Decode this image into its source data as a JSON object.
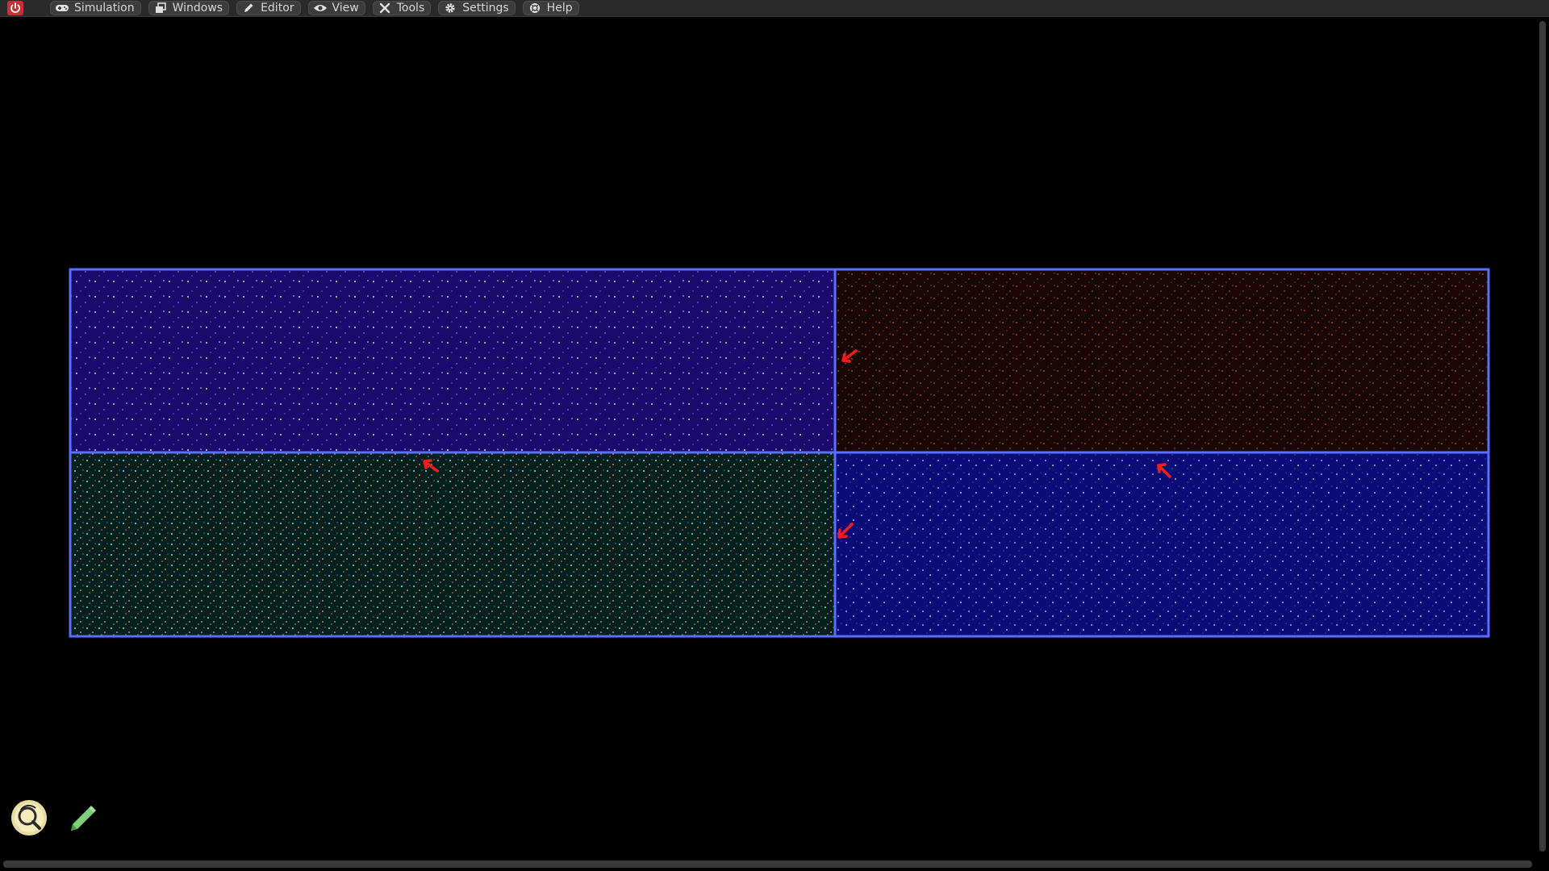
{
  "menubar": {
    "power_icon": "power-icon",
    "items": [
      {
        "label": "Simulation",
        "icon": "gamepad-icon"
      },
      {
        "label": "Windows",
        "icon": "windows-icon"
      },
      {
        "label": "Editor",
        "icon": "pencil-icon"
      },
      {
        "label": "View",
        "icon": "eye-icon"
      },
      {
        "label": "Tools",
        "icon": "wrench-icon"
      },
      {
        "label": "Settings",
        "icon": "gear-icon"
      },
      {
        "label": "Help",
        "icon": "help-icon"
      }
    ]
  },
  "colors": {
    "menubar_bg": "#2a2a2a",
    "menu_button_bg": "#3c3c3c",
    "menu_text": "#d6d6d6",
    "power_red": "#e8404a",
    "region_border": "#5a6eff",
    "arrow_red": "#ff1a1a",
    "region_top_left": "#1a0a6e",
    "region_top_right": "#1a0606",
    "region_bottom_left": "#06201e",
    "region_bottom_right": "#0c0c78"
  },
  "canvas": {
    "regions": [
      {
        "name": "top-left",
        "tint": "purple"
      },
      {
        "name": "top-right",
        "tint": "dark-red"
      },
      {
        "name": "bottom-left",
        "tint": "teal"
      },
      {
        "name": "bottom-right",
        "tint": "blue"
      }
    ],
    "arrows": [
      "red-arrow",
      "red-arrow",
      "red-arrow",
      "red-arrow"
    ]
  },
  "toolbox": {
    "items": [
      {
        "icon": "zoom-search-icon"
      },
      {
        "icon": "pencil-tool-icon"
      }
    ]
  }
}
